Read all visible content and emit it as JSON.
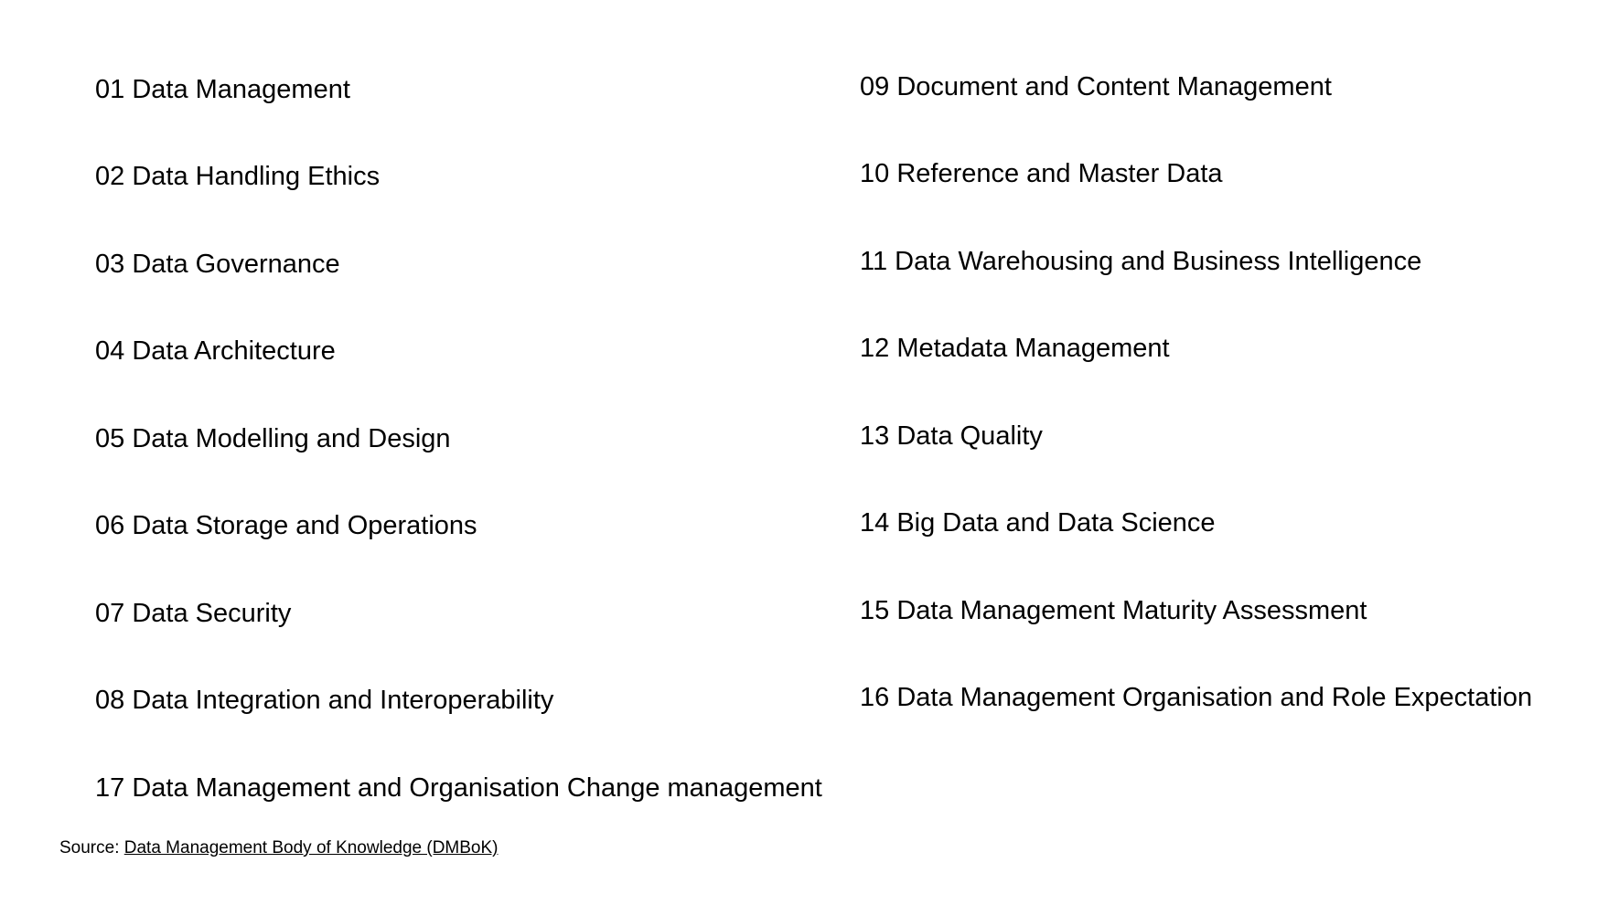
{
  "left_items": [
    "01 Data Management",
    "02 Data Handling Ethics",
    "03 Data Governance",
    "04 Data Architecture",
    "05 Data Modelling and Design",
    "06 Data Storage and Operations",
    "07 Data Security",
    "08 Data Integration and Interoperability",
    "17 Data Management and Organisation Change management"
  ],
  "right_items": [
    "09 Document and Content Management",
    "10 Reference and Master Data",
    "11 Data Warehousing and Business Intelligence",
    "12 Metadata Management",
    "13 Data Quality",
    "14 Big Data and Data Science",
    "15 Data Management Maturity Assessment",
    "16 Data Management Organisation and Role Expectation"
  ],
  "source": {
    "prefix": "Source:",
    "link_text": "Data Management Body of Knowledge (DMBoK)"
  }
}
